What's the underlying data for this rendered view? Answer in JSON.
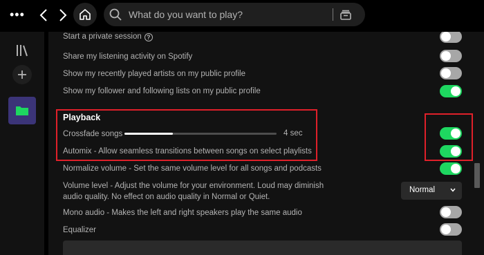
{
  "topbar": {
    "more_label": "•••",
    "search_placeholder": "What do you want to play?"
  },
  "settings": {
    "private_session": {
      "label": "Start a private session",
      "on": false
    },
    "share_activity": {
      "label": "Share my listening activity on Spotify",
      "on": false
    },
    "recent_artists": {
      "label": "Show my recently played artists on my public profile",
      "on": false
    },
    "follower_lists": {
      "label": "Show my follower and following lists on my public profile",
      "on": true
    }
  },
  "playback": {
    "title": "Playback",
    "crossfade": {
      "label": "Crossfade songs",
      "value": "4 sec",
      "fill_fraction": 0.32,
      "on": true
    },
    "automix": {
      "label": "Automix - Allow seamless transitions between songs on select playlists",
      "on": true
    },
    "normalize": {
      "label": "Normalize volume - Set the same volume level for all songs and podcasts",
      "on": true
    },
    "volume_level": {
      "label_line1": "Volume level - Adjust the volume for your environment. Loud may diminish",
      "label_line2": "audio quality. No effect on audio quality in Normal or Quiet.",
      "selected": "Normal"
    },
    "mono_audio": {
      "label": "Mono audio - Makes the left and right speakers play the same audio",
      "on": false
    },
    "equalizer": {
      "label": "Equalizer",
      "on": false
    }
  },
  "colors": {
    "accent_green": "#1ed760",
    "highlight_red": "#e0202a",
    "folder_purple": "#3b3478"
  }
}
